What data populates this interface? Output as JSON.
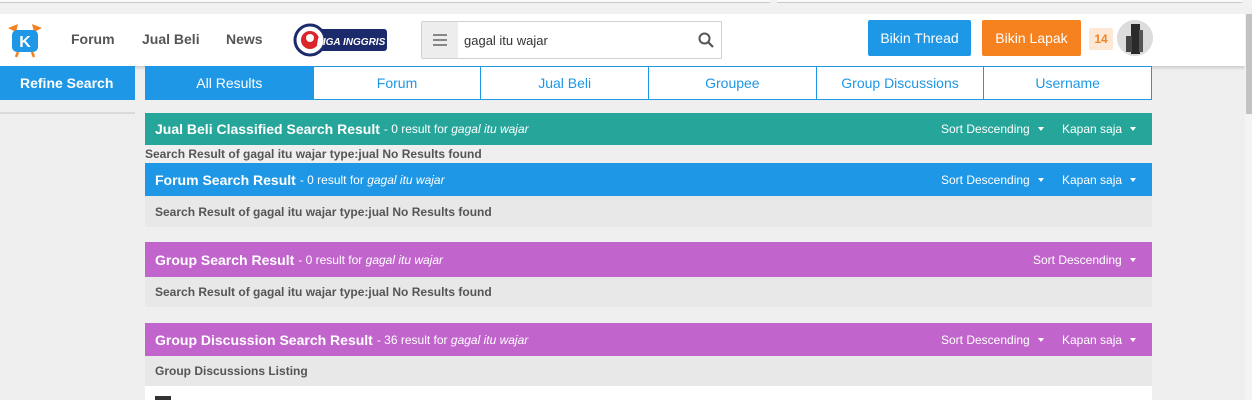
{
  "header": {
    "nav": {
      "forum": "Forum",
      "jual_beli": "Jual Beli",
      "news": "News"
    },
    "liga": {
      "text": "LIGA INGGRIS"
    },
    "search": {
      "value": "gagal itu wajar"
    },
    "buttons": {
      "thread": "Bikin Thread",
      "lapak": "Bikin Lapak"
    },
    "notification_count": "14"
  },
  "sidebar": {
    "refine": "Refine Search"
  },
  "tabs": [
    {
      "label": "All Results",
      "active": true
    },
    {
      "label": "Forum"
    },
    {
      "label": "Jual Beli"
    },
    {
      "label": "Groupee"
    },
    {
      "label": "Group Discussions"
    },
    {
      "label": "Username"
    }
  ],
  "sections": {
    "jual_beli": {
      "title": "Jual Beli Classified Search Result",
      "count_text": "- 0 result for",
      "query": "gagal itu wajar",
      "sort": "Sort Descending",
      "time": "Kapan saja",
      "note": "Search Result of gagal itu wajar type:jual No Results found"
    },
    "forum": {
      "title": "Forum Search Result",
      "count_text": "- 0 result for",
      "query": "gagal itu wajar",
      "sort": "Sort Descending",
      "time": "Kapan saja",
      "note": "Search Result of gagal itu wajar type:jual No Results found"
    },
    "group": {
      "title": "Group Search Result",
      "count_text": "- 0 result for",
      "query": "gagal itu wajar",
      "sort": "Sort Descending",
      "note": "Search Result of gagal itu wajar type:jual No Results found"
    },
    "group_discussion": {
      "title": "Group Discussion Search Result",
      "count_text": "- 36 result for",
      "query": "gagal itu wajar",
      "sort": "Sort Descending",
      "time": "Kapan saja",
      "note": "Group Discussions Listing"
    }
  },
  "colors": {
    "blue": "#1e97e6",
    "orange": "#f5811f",
    "teal": "#26a69a",
    "purple": "#c165cc"
  }
}
